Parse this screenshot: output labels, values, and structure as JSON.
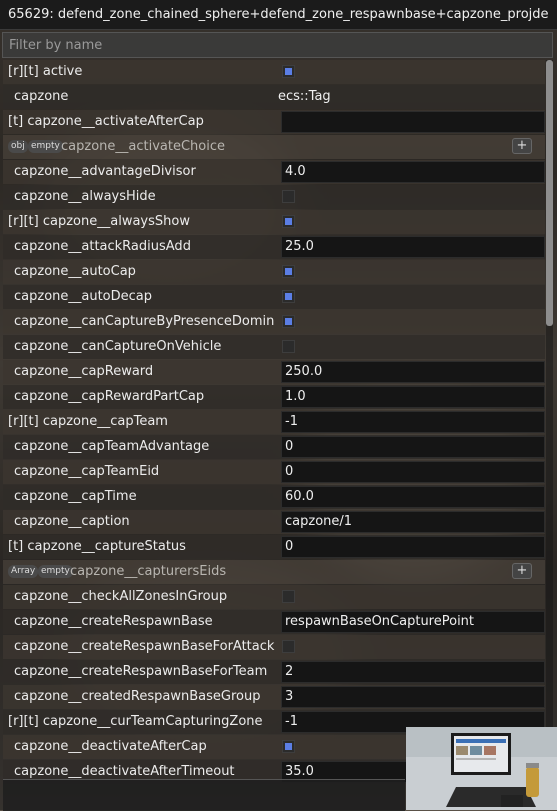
{
  "window": {
    "title": "65629: defend_zone_chained_sphere+defend_zone_respawnbase+capzone_projde"
  },
  "filter": {
    "placeholder": "Filter by name",
    "value": ""
  },
  "groups": {
    "activateChoice": {
      "tag1": "obj",
      "tag2": "empty",
      "label": "capzone__activateChoice",
      "add_label": "+"
    },
    "capturersEids": {
      "tag1": "Array",
      "tag2": "empty",
      "label": "capzone__capturersEids",
      "add_label": "+"
    }
  },
  "rows": [
    {
      "label": "[r][t] active",
      "type": "checkbox",
      "checked": true
    },
    {
      "label": "capzone",
      "type": "text",
      "value": "ecs::Tag"
    },
    {
      "label": "[t] capzone__activateAfterCap",
      "type": "field",
      "value": ""
    },
    {
      "label": "capzone__advantageDivisor",
      "type": "field",
      "value": "4.0"
    },
    {
      "label": "capzone__alwaysHide",
      "type": "checkbox",
      "checked": false
    },
    {
      "label": "[r][t] capzone__alwaysShow",
      "type": "checkbox",
      "checked": true
    },
    {
      "label": "capzone__attackRadiusAdd",
      "type": "field",
      "value": "25.0"
    },
    {
      "label": "capzone__autoCap",
      "type": "checkbox",
      "checked": true
    },
    {
      "label": "capzone__autoDecap",
      "type": "checkbox",
      "checked": true
    },
    {
      "label": "capzone__canCaptureByPresenceDomin",
      "type": "checkbox",
      "checked": true
    },
    {
      "label": "capzone__canCaptureOnVehicle",
      "type": "checkbox",
      "checked": false
    },
    {
      "label": "capzone__capReward",
      "type": "field",
      "value": "250.0"
    },
    {
      "label": "capzone__capRewardPartCap",
      "type": "field",
      "value": "1.0"
    },
    {
      "label": "[r][t] capzone__capTeam",
      "type": "field",
      "value": "-1"
    },
    {
      "label": "capzone__capTeamAdvantage",
      "type": "field",
      "value": "0"
    },
    {
      "label": "capzone__capTeamEid",
      "type": "field",
      "value": "0"
    },
    {
      "label": "capzone__capTime",
      "type": "field",
      "value": "60.0"
    },
    {
      "label": "capzone__caption",
      "type": "field",
      "value": "capzone/1"
    },
    {
      "label": "[t] capzone__captureStatus",
      "type": "field",
      "value": "0"
    },
    {
      "label": "capzone__checkAllZonesInGroup",
      "type": "checkbox",
      "checked": false
    },
    {
      "label": "capzone__createRespawnBase",
      "type": "field",
      "value": "respawnBaseOnCapturePoint"
    },
    {
      "label": "capzone__createRespawnBaseForAttack",
      "type": "checkbox",
      "checked": false
    },
    {
      "label": "capzone__createRespawnBaseForTeam",
      "type": "field",
      "value": "2"
    },
    {
      "label": "capzone__createdRespawnBaseGroup",
      "type": "field",
      "value": "3"
    },
    {
      "label": "[r][t] capzone__curTeamCapturingZone",
      "type": "field",
      "value": "-1"
    },
    {
      "label": "capzone__deactivateAfterCap",
      "type": "checkbox",
      "checked": true
    },
    {
      "label": "capzone__deactivateAfterTimeout",
      "type": "field",
      "value": "35.0"
    }
  ],
  "colors": {
    "accent": "#5b7ee5",
    "field_bg": "#151515",
    "title_bg": "#1b1b1b"
  }
}
